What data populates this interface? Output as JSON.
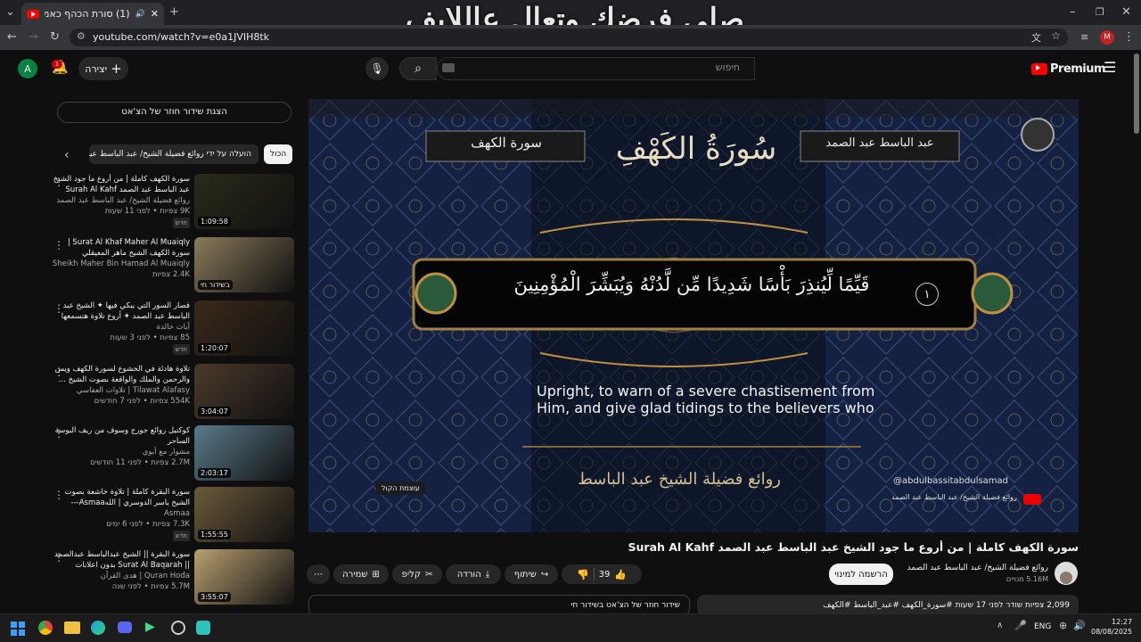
{
  "browser": {
    "tab_title": "(1) סורת הכהף כאמלה | من أ",
    "url": "youtube.com/watch?v=e0a1JVIH8tk",
    "profile_initial": "M"
  },
  "overlay_text": "صلي فرضك وتعال عاللايف",
  "header": {
    "avatar_initial": "A",
    "notif_count": "1",
    "create_label": "יצירה",
    "search_placeholder": "חיפוש",
    "premium_label": "Premium"
  },
  "sidebar": {
    "chat_button": "הצגת שידור חוזר של הצ'אט",
    "chips": [
      "הכול",
      "הועלה על ידי روائع فضيلة الشيخ/ عبد الباسط عبد الصمد"
    ],
    "items": [
      {
        "title": "سورة الكهف كاملة | من أروع ما جود الشيخ عبد الباسط عبد الصمد Surah Al Kahf",
        "channel": "روائع فضيلة الشيخ/ عبد الباسط عبد الصمد",
        "views": "9K צפיות • לפני 11 שעות",
        "badge": "חדש",
        "duration": "1:09:58",
        "thumb": "#2a2a1a"
      },
      {
        "title": "Surat Al Khaf Maher Al Muaiqly | سورة الكهف الشيخ ماهر المعيقلي",
        "channel": "Al Sheikh Maher Bin Hamad Al Muaiqly | ...",
        "views": "2.4K צפיות",
        "badge": "",
        "duration": "בשידור חי",
        "thumb": "#8a7a5a"
      },
      {
        "title": "قصار السور التي يبكي فيها ✦ الشيخ عبد الباسط عبد الصمد ✦ أروع تلاوة هتسمعها ...",
        "channel": "آيات خالدة",
        "views": "85 צפיות • לפני 3 שעות",
        "badge": "חדש",
        "duration": "1:20:07",
        "thumb": "#3a2a1a"
      },
      {
        "title": "تلاوة هادئة في الخشوع لسورة الكهف ويس والرحمن والملك والواقعة بصوت الشيخ ...",
        "channel": "Tilawat Alafasy | تلاوات العفاسي",
        "views": "554K צפיות • לפני 7 חודשים",
        "badge": "",
        "duration": "3:04:07",
        "thumb": "#4a3a2a"
      },
      {
        "title": "كوكتيل روائع جورج وسوف من ريف البوسة الساحر",
        "channel": "مشوار مع أبوي",
        "views": "2.7M צפיות • לפני 11 חודשים",
        "badge": "",
        "duration": "2:03:17",
        "thumb": "#5a7a8a"
      },
      {
        "title": "سورة البقرة كاملة | تلاوة خاشعة بصوت الشيخ ياسر الدوسري | اللهAsmaa---",
        "channel": "Asmaa",
        "views": "7.3K צפיות • לפני 6 ימים",
        "badge": "חדש",
        "duration": "1:55:55",
        "thumb": "#6a5a3a"
      },
      {
        "title": "سورة البقرة || الشيخ عبدالباسط عبدالصمد || Surat Al Baqarah بدون اعلانات",
        "channel": "Quran Hoda | هدى القرآن",
        "views": "5.7M צפיות • לפני שנה",
        "badge": "",
        "duration": "3:55:07",
        "thumb": "#b8a070"
      }
    ]
  },
  "video": {
    "surah_label": "سورة الكهف",
    "reciter_label": "عبد الباسط عبد الصمد",
    "calligraphy": "سُورَةُ الكَهْفِ",
    "verse_number": "١",
    "verse_text": "قَيِّمًا لِّيُنذِرَ بَأْسًا شَدِيدًا مِّن لَّدُنْهُ وَيُبَشِّرَ الْمُؤْمِنِينَ",
    "translation": "Upright, to warn of a severe chastisement from Him, and give glad tidings to the believers who",
    "handle": "@abdulbassitabdulsamad",
    "channel_tag": "روائع فضيلة الشيخ/ عبد الباسط عبد الصمد",
    "footer_calligraphy": "روائع فضيلة الشيخ عبد الباسط عبد الصمد",
    "tooltip": "עוצמת הקול"
  },
  "info": {
    "title": "سورة الكهف كاملة | من أروع ما جود الشيخ عبد الباسط عبد الصمد Surah Al Kahf",
    "channel_name": "روائع فضيلة الشيخ/ عبد الباسط عبد الصمد",
    "subscribers": "5.16M מנויים",
    "subscribe_label": "הרשמה למינוי",
    "likes": "39",
    "share_label": "שיתוף",
    "download_label": "הורדה",
    "clip_label": "קליפ",
    "save_label": "שמירה",
    "views_line": "2,099 צפיות  שודר לפני 17 שעות  #سورة_الكهف #عبد_الباسط #الكهف",
    "chat_replay": "שידור חוזר של הצ'אט בשידור חי"
  },
  "taskbar": {
    "lang": "ENG",
    "time": "12:27",
    "date": "08/08/2025"
  }
}
